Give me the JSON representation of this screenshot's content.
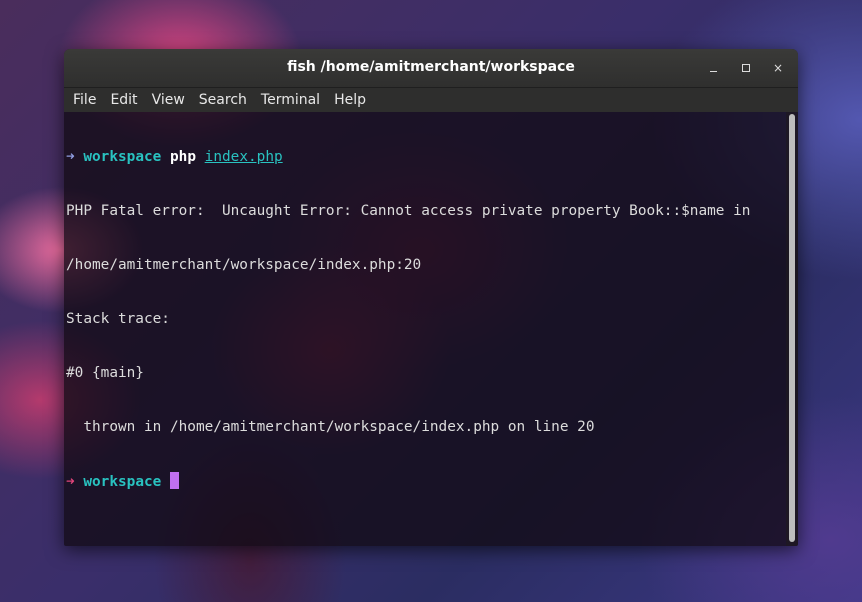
{
  "window": {
    "title": "fish  /home/amitmerchant/workspace",
    "minimize_icon": "minimize-icon",
    "maximize_icon": "maximize-icon",
    "close_label": "×"
  },
  "menu": {
    "items": [
      "File",
      "Edit",
      "View",
      "Search",
      "Terminal",
      "Help"
    ]
  },
  "terminal": {
    "prompt1": {
      "arrow": "➜",
      "cwd": "workspace",
      "command": "php",
      "argument": "index.php"
    },
    "output": [
      "PHP Fatal error:  Uncaught Error: Cannot access private property Book::$name in",
      "/home/amitmerchant/workspace/index.php:20",
      "Stack trace:",
      "#0 {main}",
      "  thrown in /home/amitmerchant/workspace/index.php on line 20"
    ],
    "prompt2": {
      "arrow": "➜",
      "cwd": "workspace"
    }
  },
  "colors": {
    "arrow_success": "#8f9ce0",
    "arrow_error": "#e0457a",
    "cwd": "#29c2c0",
    "cursor": "#c070f0"
  }
}
